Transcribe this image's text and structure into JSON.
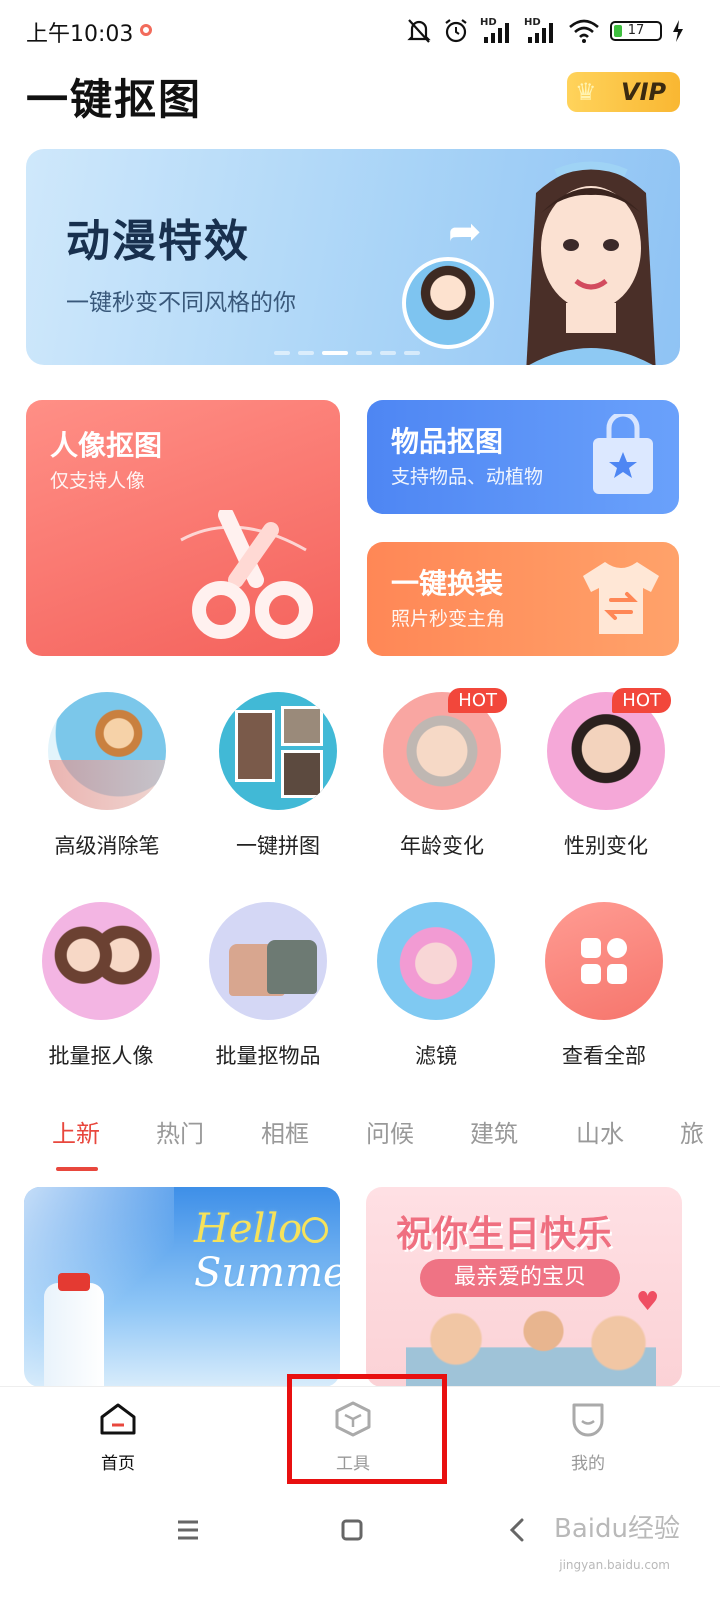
{
  "status_bar": {
    "time": "上午10:03",
    "hd1": "HD",
    "hd2": "HD",
    "battery": "17"
  },
  "header": {
    "app_title": "一键抠图",
    "vip_label": "VIP"
  },
  "banner": {
    "title": "动漫特效",
    "subtitle": "一键秒变不同风格的你",
    "page_count": 6,
    "active_page": 3
  },
  "feature_cards": {
    "portrait": {
      "title": "人像抠图",
      "subtitle": "仅支持人像"
    },
    "object": {
      "title": "物品抠图",
      "subtitle": "支持物品、动植物"
    },
    "outfit": {
      "title": "一键换装",
      "subtitle": "照片秒变主角"
    }
  },
  "tools": {
    "hot_label": "HOT",
    "row1": [
      {
        "label": "高级消除笔",
        "hot": false
      },
      {
        "label": "一键拼图",
        "hot": false
      },
      {
        "label": "年龄变化",
        "hot": true
      },
      {
        "label": "性别变化",
        "hot": true
      }
    ],
    "row2": [
      {
        "label": "批量抠人像"
      },
      {
        "label": "批量抠物品"
      },
      {
        "label": "滤镜"
      },
      {
        "label": "查看全部"
      }
    ]
  },
  "category_tabs": [
    "上新",
    "热门",
    "相框",
    "问候",
    "建筑",
    "山水",
    "旅"
  ],
  "thumbnails": {
    "summer_text_line1": "Hello",
    "summer_text_line2": "Summer",
    "birthday_title": "祝你生日快乐",
    "birthday_pill": "最亲爱的宝贝"
  },
  "bottom_nav": [
    {
      "label": "首页",
      "icon": "home-icon",
      "active": true
    },
    {
      "label": "工具",
      "icon": "cube-icon",
      "active": false
    },
    {
      "label": "我的",
      "icon": "profile-icon",
      "active": false
    }
  ],
  "watermark": {
    "text": "Baidu经验",
    "url": "jingyan.baidu.com"
  },
  "colors": {
    "accent": "#e8473d",
    "highlight_box": "#e81010",
    "vip_gold": "#f9b732"
  }
}
